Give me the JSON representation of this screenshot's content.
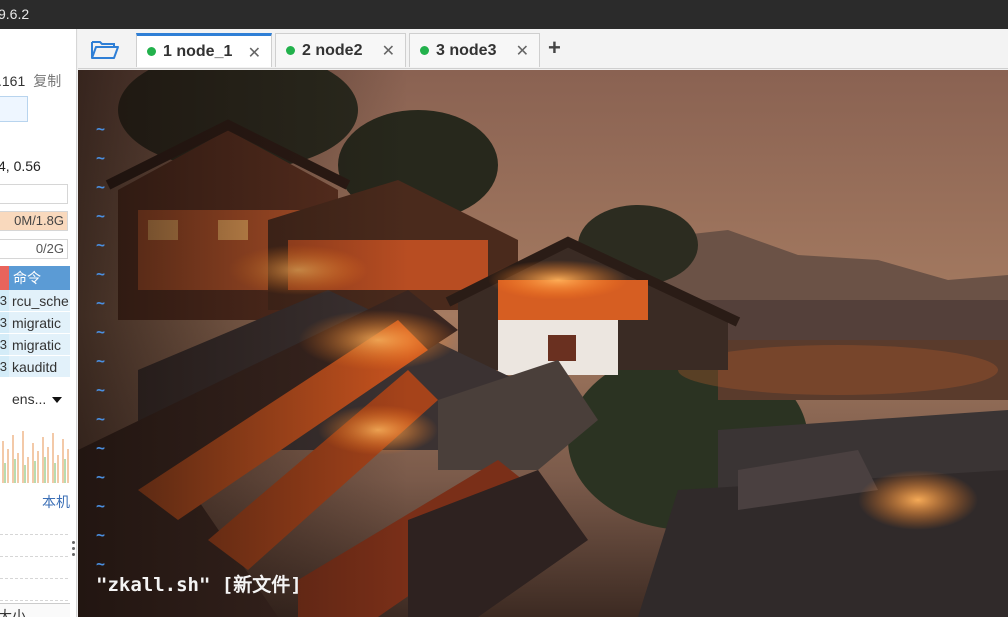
{
  "window": {
    "title_fragment": "9.6.2"
  },
  "left_panel": {
    "ip_fragment": ".161",
    "copy_label": "复制",
    "load_fragment": "4, 0.56",
    "memory_fragment": "0M/1.8G",
    "swap_fragment": "0/2G",
    "process_header": "命令",
    "processes": [
      {
        "num": "3",
        "cmd": "rcu_sche"
      },
      {
        "num": "3",
        "cmd": "migratic"
      },
      {
        "num": "3",
        "cmd": "migratic"
      },
      {
        "num": "3",
        "cmd": "kauditd"
      }
    ],
    "network_interface_fragment": "ens...",
    "local_label": "本机",
    "size_label_fragment": "大小"
  },
  "tabs": [
    {
      "label": "1 node_1",
      "active": true,
      "status_color": "#22b14c"
    },
    {
      "label": "2 node2",
      "active": false,
      "status_color": "#22b14c"
    },
    {
      "label": "3 node3",
      "active": false,
      "status_color": "#22b14c"
    }
  ],
  "icons": {
    "open_folder": "folder-open-icon",
    "add_tab": "plus-icon",
    "close_tab": "close-icon"
  },
  "terminal": {
    "tilde_lines": [
      "~",
      "~",
      "~",
      "~",
      "~",
      "~",
      "~",
      "~",
      "~",
      "~",
      "~",
      "~",
      "~",
      "~",
      "~",
      "~"
    ],
    "status_line": "\"zkall.sh\" [新文件]"
  },
  "colors": {
    "tab_active_accent": "#2f7fd6",
    "process_header_bg": "#5b9bd5",
    "tilde_color": "#4a8fe0"
  }
}
